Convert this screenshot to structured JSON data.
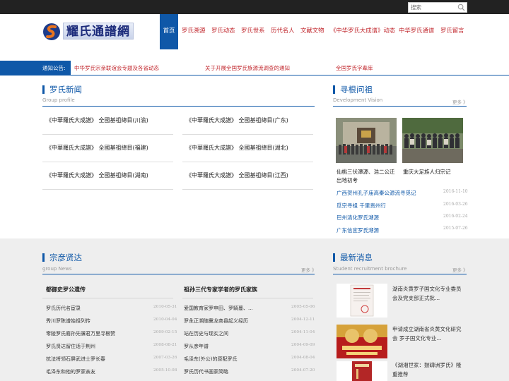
{
  "search": {
    "placeholder": "搜索"
  },
  "logo": {
    "text": "耀氏通譜網"
  },
  "nav": [
    {
      "label": "首页",
      "active": true
    },
    {
      "label": "罗氏溯源"
    },
    {
      "label": "罗氏动态"
    },
    {
      "label": "罗氏世系"
    },
    {
      "label": "历代名人"
    },
    {
      "label": "文献文物"
    },
    {
      "label": "《中华罗氏大成谱》动态"
    },
    {
      "label": "中华罗氏通谱"
    },
    {
      "label": "罗氏留言"
    }
  ],
  "notice": {
    "label": "通知公告:",
    "links": [
      "中华罗氏宗亲联谊会专题及各省动态",
      "关于开展全国罗氏族源流调查的通知",
      "全国罗氏字辈库"
    ]
  },
  "luoshi_news": {
    "title": "罗氏新闻",
    "subtitle": "Group profile",
    "items": [
      "《中華羅氏大成譜》 全國基祖總目(川渝)",
      "《中華羅氏大成譜》 全國基祖總目(广东)",
      "《中華羅氏大成譜》 全國基祖總目(福建)",
      "《中華羅氏大成譜》 全國基祖總目(湖北)",
      "《中華羅氏大成譜》 全國基祖總目(湖南)",
      "《中華羅氏大成譜》 全國基祖總目(江西)"
    ]
  },
  "xungen": {
    "title": "寻根问祖",
    "subtitle": "Development Vision",
    "more": "更多 》",
    "captions": [
      "仙桃三伏潭源、浩二公迁出地初考",
      "重庆大足族人归宗记"
    ],
    "links": [
      {
        "title": "广西贺州孔子庙高秦公源流寻觅记",
        "date": "2016-11-10"
      },
      {
        "title": "觅宗寻祖 千里贵州行",
        "date": "2016-03-26"
      },
      {
        "title": "巴州清化罗氏溯源",
        "date": "2016-02-24"
      },
      {
        "title": "广东信宜罗氏溯源",
        "date": "2015-07-26"
      }
    ]
  },
  "zongyan": {
    "title": "宗彦贤达",
    "subtitle": "group News",
    "more": "更多 》",
    "left": {
      "head": "都御史罗公遗传",
      "items": [
        {
          "title": "罗氏历代名宦录",
          "date": "2010-05-31"
        },
        {
          "title": "秀川罗陈谱始祖列传",
          "date": "2010-04-04"
        },
        {
          "title": "零陵罗氏裔孙先骥君万里寻根赞",
          "date": "2009-02-15"
        },
        {
          "title": "罗氏贤达留住话于荆州",
          "date": "2008-08-21"
        },
        {
          "title": "抗法将领石屏武进士罗长春",
          "date": "2007-03-26"
        },
        {
          "title": "毛泽东和他的罗家亲友",
          "date": "2005-10-08"
        }
      ]
    },
    "right": {
      "head": "祖孙三代专家学者的罗氏家族",
      "items": [
        {
          "title": "爱国教育家罗申田、罗騎蔓、...",
          "date": "2005-05-06"
        },
        {
          "title": "罗永正溯随冀龙商县起义经历",
          "date": "2004-12-11"
        },
        {
          "title": "站在历史与现实之间",
          "date": "2004-11-04"
        },
        {
          "title": "罗从彦年谱",
          "date": "2004-09-09"
        },
        {
          "title": "毛泽东(外公)的原配罗氏",
          "date": "2004-08-04"
        },
        {
          "title": "罗氏历代书画家简略",
          "date": "2004-07-20"
        }
      ]
    }
  },
  "latest": {
    "title": "最新消息",
    "subtitle": "Student recruitment brochure",
    "more": "更多 》",
    "items": [
      "湖南炎黄罗子国文化专业委员会及党支部正式批...",
      "申请成立湖南省炎黄文化研究会 罗子国文化专业...",
      "《湖湘世家：鼓礴洲罗氏》隆重推荐"
    ]
  },
  "colors": {
    "brand_blue": "#0f58a8",
    "accent_red": "#c1272d",
    "topbar": "#222222"
  }
}
